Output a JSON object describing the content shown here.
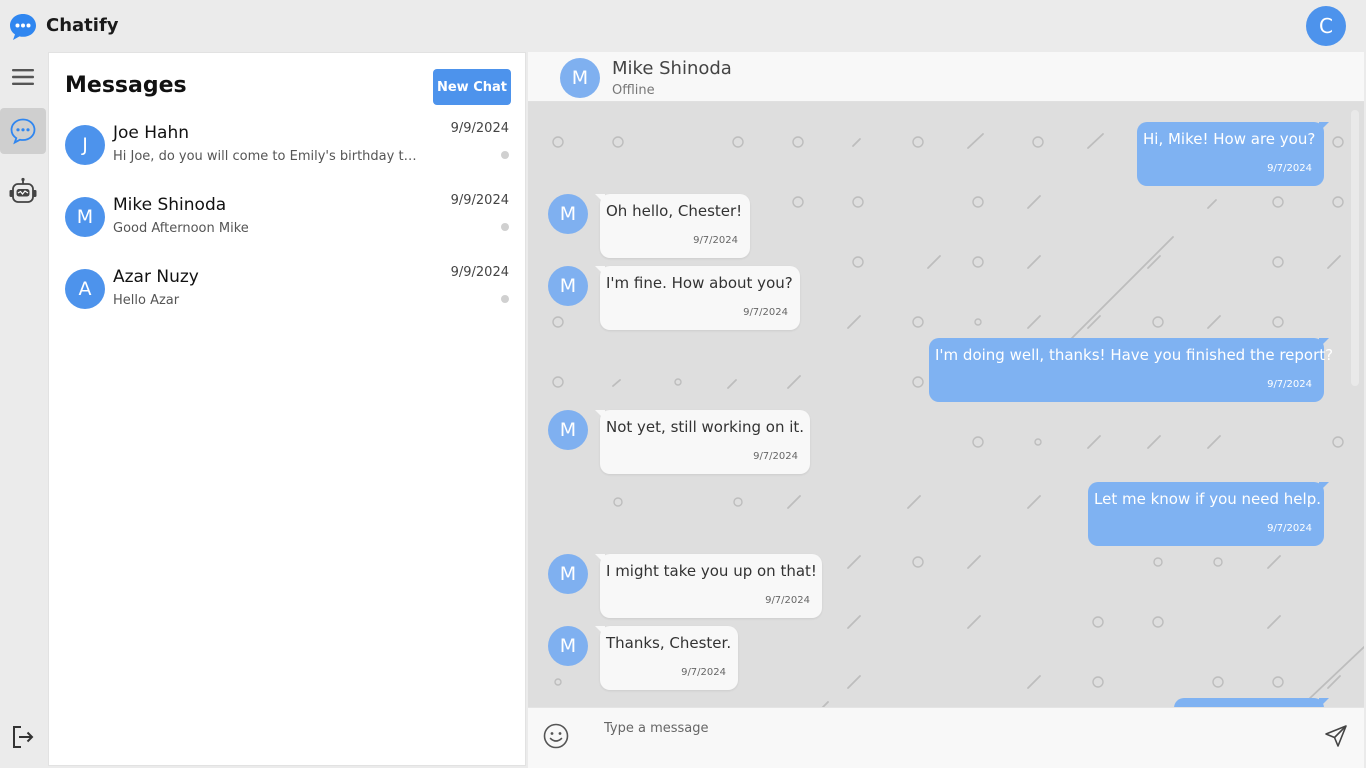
{
  "app": {
    "title": "Chatify",
    "user_initial": "C",
    "accent_color": "#4d93ec",
    "bubble_out_color": "#7fb2f2"
  },
  "rail": {
    "items": [
      {
        "icon": "menu-icon"
      },
      {
        "icon": "chat-icon",
        "active": true
      },
      {
        "icon": "bot-icon"
      },
      {
        "icon": "logout-icon"
      }
    ]
  },
  "messages_panel": {
    "title": "Messages",
    "new_chat_label": "New Chat",
    "conversations": [
      {
        "initial": "J",
        "name": "Joe Hahn",
        "preview": "Hi Joe, do you will come to Emily's birthday this weekend?",
        "date": "9/9/2024"
      },
      {
        "initial": "M",
        "name": "Mike Shinoda",
        "preview": "Good Afternoon Mike",
        "date": "9/9/2024"
      },
      {
        "initial": "A",
        "name": "Azar Nuzy",
        "preview": "Hello Azar",
        "date": "9/9/2024"
      }
    ]
  },
  "chat": {
    "contact_initial": "M",
    "contact_name": "Mike Shinoda",
    "contact_status": "Offline",
    "messages": [
      {
        "direction": "out",
        "text": "Hi, Mike! How are you?",
        "time": "9/7/2024"
      },
      {
        "direction": "in",
        "initial": "M",
        "text": "Oh hello, Chester!",
        "time": "9/7/2024"
      },
      {
        "direction": "in",
        "initial": "M",
        "text": "I'm fine. How about you?",
        "time": "9/7/2024"
      },
      {
        "direction": "out",
        "text": "I'm doing well, thanks! Have you finished the report?",
        "time": "9/7/2024"
      },
      {
        "direction": "in",
        "initial": "M",
        "text": "Not yet, still working on it.",
        "time": "9/7/2024"
      },
      {
        "direction": "out",
        "text": "Let me know if you need help.",
        "time": "9/7/2024"
      },
      {
        "direction": "in",
        "initial": "M",
        "text": "I might take you up on that!",
        "time": "9/7/2024"
      },
      {
        "direction": "in",
        "initial": "M",
        "text": "Thanks, Chester.",
        "time": "9/7/2024"
      }
    ],
    "composer": {
      "placeholder": "Type a message",
      "value": ""
    }
  }
}
